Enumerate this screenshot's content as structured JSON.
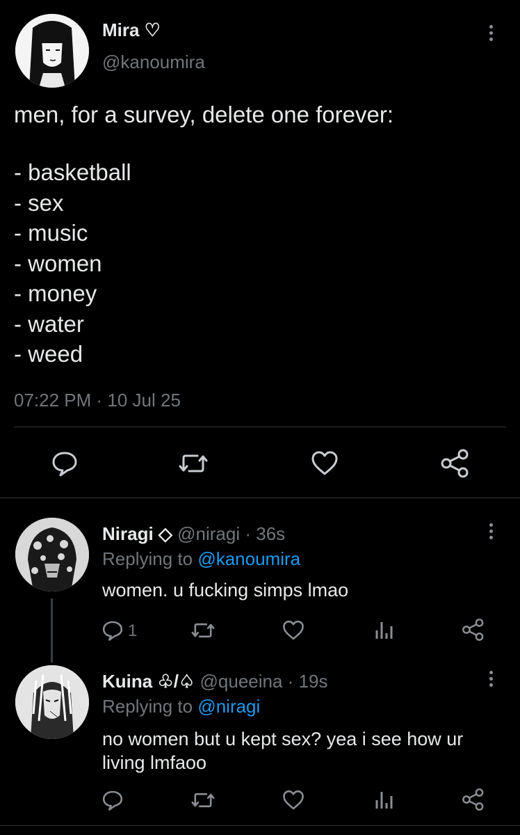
{
  "main_tweet": {
    "display_name": "Mira ♡",
    "handle": "@kanoumira",
    "text_first_line": "men, for a survey, delete one forever:",
    "options": [
      "- basketball",
      "- sex",
      "- music",
      "- women",
      "- money",
      "- water",
      "- weed"
    ],
    "timestamp": "07:22 PM · 10 Jul 25"
  },
  "replies": [
    {
      "display_name": "Niragi ◇",
      "handle_time": "@niragi · 36s",
      "replying_prefix": "Replying to",
      "replying_to": "@kanoumira",
      "text": "women. u fucking simps lmao",
      "reply_count": "1"
    },
    {
      "display_name": "Kuina ♧/♤",
      "handle_time": "@queeina · 19s",
      "replying_prefix": "Replying to",
      "replying_to": "@niragi",
      "text_line1": "no women but u kept sex? yea i see how ur",
      "text_line2": "living lmfaoo"
    }
  ],
  "colors": {
    "background": "#000000",
    "text": "#e7e9ea",
    "muted": "#71767b",
    "link": "#1d9bf0",
    "divider": "#2f3336"
  },
  "icons": [
    "more-icon",
    "comment-icon",
    "retweet-icon",
    "heart-icon",
    "share-icon",
    "analytics-icon"
  ]
}
